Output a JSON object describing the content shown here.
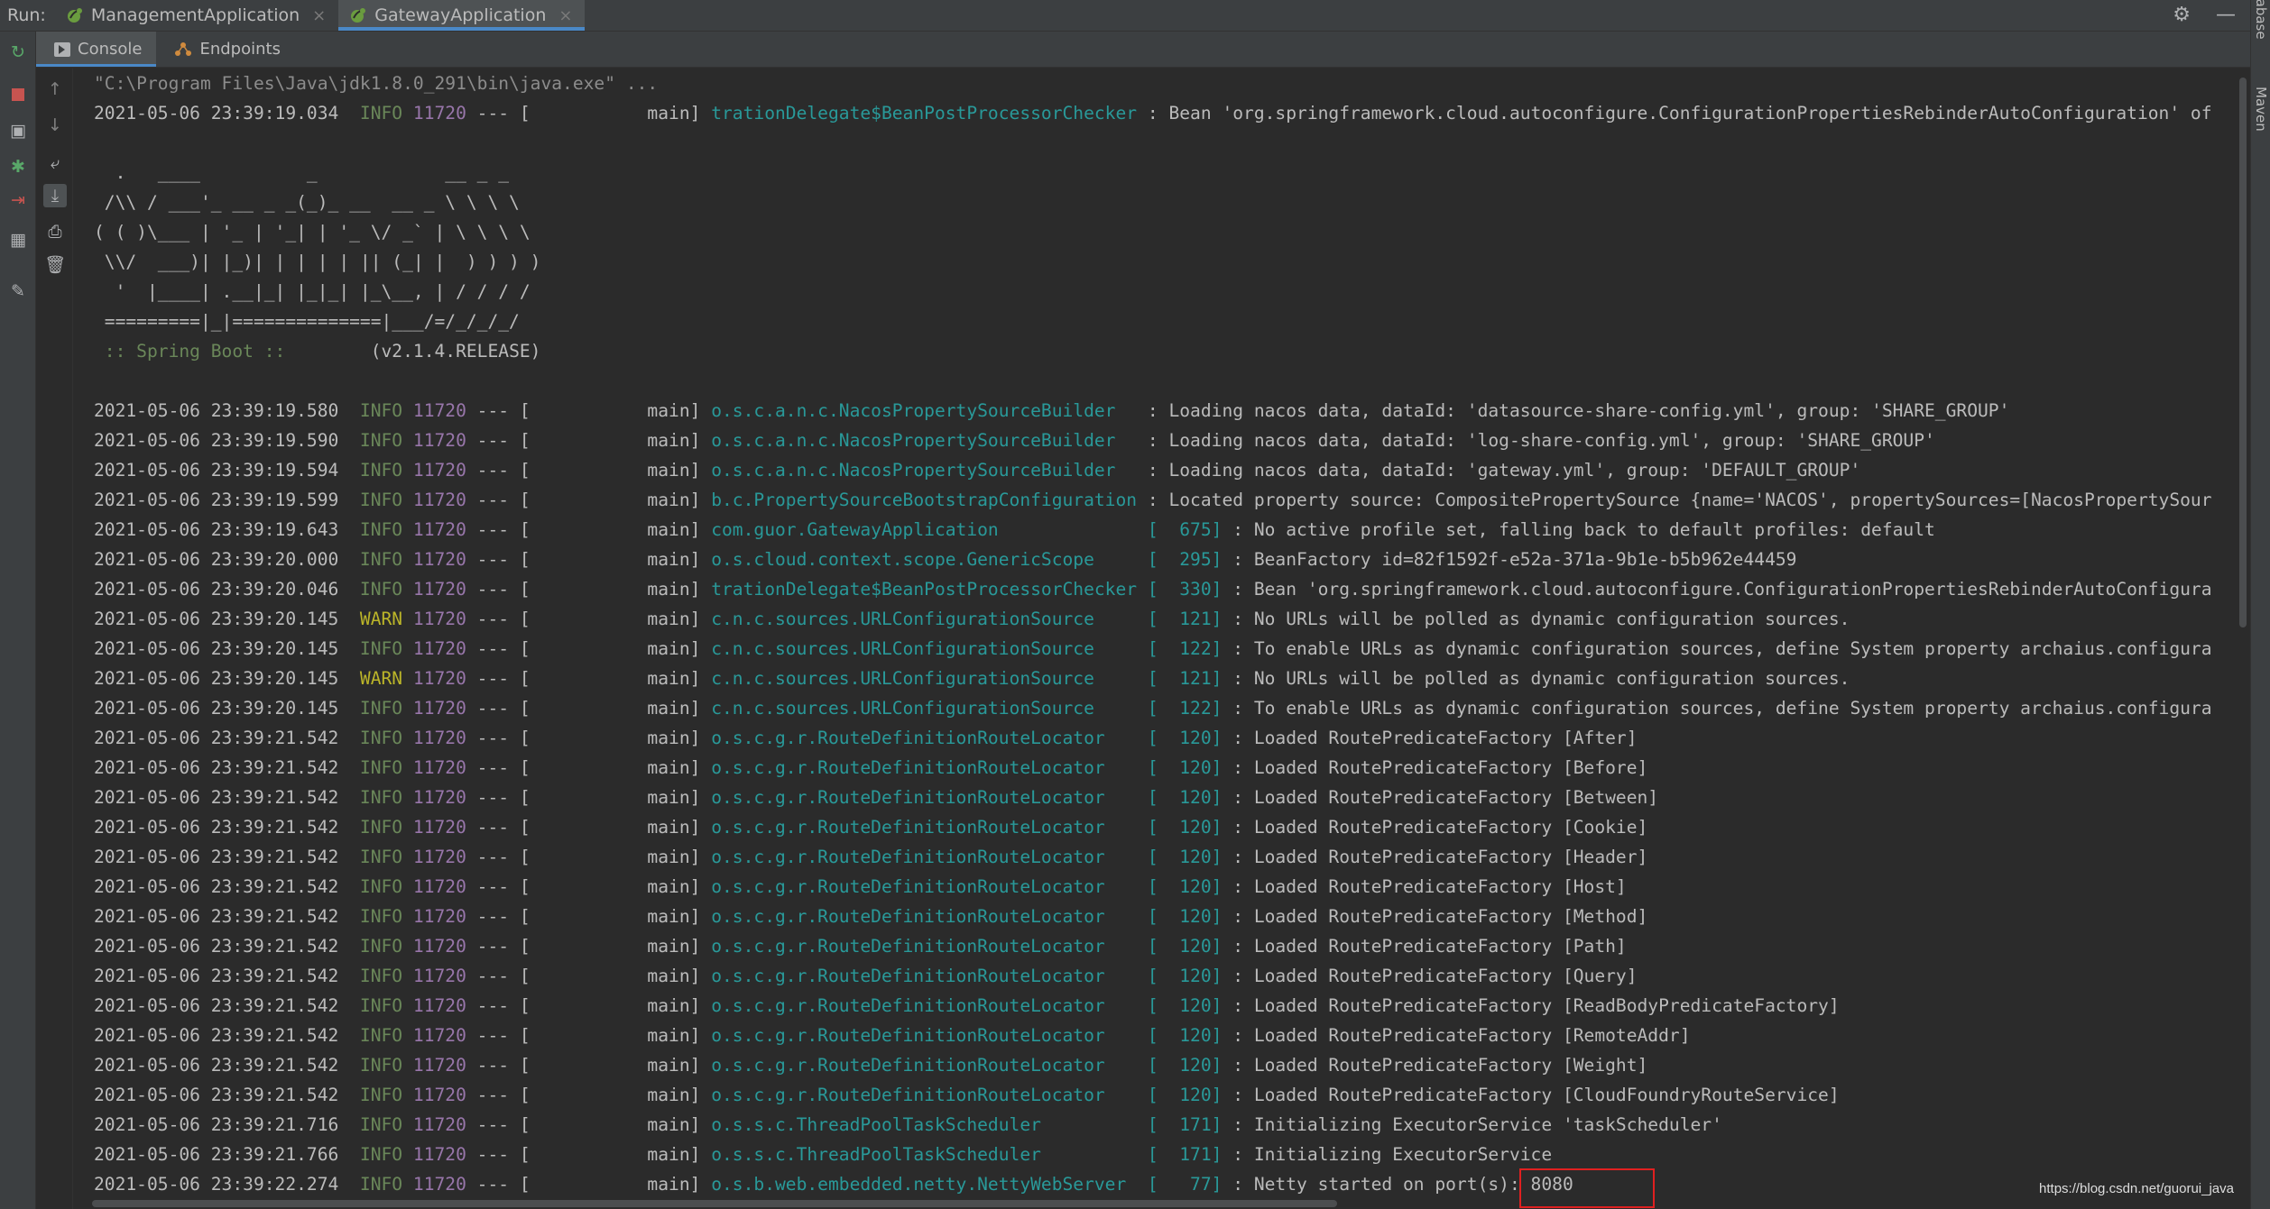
{
  "runbar": {
    "label": "Run:",
    "tabs": [
      {
        "label": "ManagementApplication",
        "active": false
      },
      {
        "label": "GatewayApplication",
        "active": true
      }
    ],
    "close_glyph": "×"
  },
  "right_strip": {
    "labels": [
      "Database",
      "Maven"
    ]
  },
  "subtabs": [
    {
      "label": "Console",
      "active": true
    },
    {
      "label": "Endpoints",
      "active": false
    }
  ],
  "colors": {
    "info": "#6a8759",
    "warn": "#bbb529",
    "pid": "#9876aa",
    "logger": "#299999",
    "highlight": "#e02020",
    "tab_accent": "#4a88c7"
  },
  "console": {
    "command": "\"C:\\Program Files\\Java\\jdk1.8.0_291\\bin\\java.exe\" ...",
    "first_log": {
      "ts": "2021-05-06 23:39:19.034",
      "level": "INFO",
      "pid": "11720",
      "sep": " --- [",
      "thread": "           main]",
      "logger": "trationDelegate$BeanPostProcessorChecker",
      "msg": " : Bean 'org.springframework.cloud.autoconfigure.ConfigurationPropertiesRebinderAutoConfiguration' of"
    },
    "banner": [
      "  .   ____          _            __ _ _",
      " /\\\\ / ___'_ __ _ _(_)_ __  __ _ \\ \\ \\ \\",
      "( ( )\\___ | '_ | '_| | '_ \\/ _` | \\ \\ \\ \\",
      " \\\\/  ___)| |_)| | | | | || (_| |  ) ) ) )",
      "  '  |____| .__|_| |_|_| |_\\__, | / / / /",
      " =========|_|==============|___/=/_/_/_/"
    ],
    "spring_boot_label": " :: Spring Boot :: ",
    "spring_boot_version": "       (v2.1.4.RELEASE)",
    "logs": [
      {
        "ts": "2021-05-06 23:39:19.580",
        "level": "INFO",
        "pid": "11720",
        "logger": "o.s.c.a.n.c.NacosPropertySourceBuilder  ",
        "lnum": "",
        "msg": " : Loading nacos data, dataId: 'datasource-share-config.yml', group: 'SHARE_GROUP'"
      },
      {
        "ts": "2021-05-06 23:39:19.590",
        "level": "INFO",
        "pid": "11720",
        "logger": "o.s.c.a.n.c.NacosPropertySourceBuilder  ",
        "lnum": "",
        "msg": " : Loading nacos data, dataId: 'log-share-config.yml', group: 'SHARE_GROUP'"
      },
      {
        "ts": "2021-05-06 23:39:19.594",
        "level": "INFO",
        "pid": "11720",
        "logger": "o.s.c.a.n.c.NacosPropertySourceBuilder  ",
        "lnum": "",
        "msg": " : Loading nacos data, dataId: 'gateway.yml', group: 'DEFAULT_GROUP'"
      },
      {
        "ts": "2021-05-06 23:39:19.599",
        "level": "INFO",
        "pid": "11720",
        "logger": "b.c.PropertySourceBootstrapConfiguration",
        "lnum": "",
        "msg": " : Located property source: CompositePropertySource {name='NACOS', propertySources=[NacosPropertySour"
      },
      {
        "ts": "2021-05-06 23:39:19.643",
        "level": "INFO",
        "pid": "11720",
        "logger": "com.guor.GatewayApplication             ",
        "lnum": "[  675]",
        "msg": " : No active profile set, falling back to default profiles: default"
      },
      {
        "ts": "2021-05-06 23:39:20.000",
        "level": "INFO",
        "pid": "11720",
        "logger": "o.s.cloud.context.scope.GenericScope    ",
        "lnum": "[  295]",
        "msg": " : BeanFactory id=82f1592f-e52a-371a-9b1e-b5b962e44459"
      },
      {
        "ts": "2021-05-06 23:39:20.046",
        "level": "INFO",
        "pid": "11720",
        "logger": "trationDelegate$BeanPostProcessorChecker",
        "lnum": "[  330]",
        "msg": " : Bean 'org.springframework.cloud.autoconfigure.ConfigurationPropertiesRebinderAutoConfigura"
      },
      {
        "ts": "2021-05-06 23:39:20.145",
        "level": "WARN",
        "pid": "11720",
        "logger": "c.n.c.sources.URLConfigurationSource    ",
        "lnum": "[  121]",
        "msg": " : No URLs will be polled as dynamic configuration sources."
      },
      {
        "ts": "2021-05-06 23:39:20.145",
        "level": "INFO",
        "pid": "11720",
        "logger": "c.n.c.sources.URLConfigurationSource    ",
        "lnum": "[  122]",
        "msg": " : To enable URLs as dynamic configuration sources, define System property archaius.configura"
      },
      {
        "ts": "2021-05-06 23:39:20.145",
        "level": "WARN",
        "pid": "11720",
        "logger": "c.n.c.sources.URLConfigurationSource    ",
        "lnum": "[  121]",
        "msg": " : No URLs will be polled as dynamic configuration sources."
      },
      {
        "ts": "2021-05-06 23:39:20.145",
        "level": "INFO",
        "pid": "11720",
        "logger": "c.n.c.sources.URLConfigurationSource    ",
        "lnum": "[  122]",
        "msg": " : To enable URLs as dynamic configuration sources, define System property archaius.configura"
      },
      {
        "ts": "2021-05-06 23:39:21.542",
        "level": "INFO",
        "pid": "11720",
        "logger": "o.s.c.g.r.RouteDefinitionRouteLocator   ",
        "lnum": "[  120]",
        "msg": " : Loaded RoutePredicateFactory [After]"
      },
      {
        "ts": "2021-05-06 23:39:21.542",
        "level": "INFO",
        "pid": "11720",
        "logger": "o.s.c.g.r.RouteDefinitionRouteLocator   ",
        "lnum": "[  120]",
        "msg": " : Loaded RoutePredicateFactory [Before]"
      },
      {
        "ts": "2021-05-06 23:39:21.542",
        "level": "INFO",
        "pid": "11720",
        "logger": "o.s.c.g.r.RouteDefinitionRouteLocator   ",
        "lnum": "[  120]",
        "msg": " : Loaded RoutePredicateFactory [Between]"
      },
      {
        "ts": "2021-05-06 23:39:21.542",
        "level": "INFO",
        "pid": "11720",
        "logger": "o.s.c.g.r.RouteDefinitionRouteLocator   ",
        "lnum": "[  120]",
        "msg": " : Loaded RoutePredicateFactory [Cookie]"
      },
      {
        "ts": "2021-05-06 23:39:21.542",
        "level": "INFO",
        "pid": "11720",
        "logger": "o.s.c.g.r.RouteDefinitionRouteLocator   ",
        "lnum": "[  120]",
        "msg": " : Loaded RoutePredicateFactory [Header]"
      },
      {
        "ts": "2021-05-06 23:39:21.542",
        "level": "INFO",
        "pid": "11720",
        "logger": "o.s.c.g.r.RouteDefinitionRouteLocator   ",
        "lnum": "[  120]",
        "msg": " : Loaded RoutePredicateFactory [Host]"
      },
      {
        "ts": "2021-05-06 23:39:21.542",
        "level": "INFO",
        "pid": "11720",
        "logger": "o.s.c.g.r.RouteDefinitionRouteLocator   ",
        "lnum": "[  120]",
        "msg": " : Loaded RoutePredicateFactory [Method]"
      },
      {
        "ts": "2021-05-06 23:39:21.542",
        "level": "INFO",
        "pid": "11720",
        "logger": "o.s.c.g.r.RouteDefinitionRouteLocator   ",
        "lnum": "[  120]",
        "msg": " : Loaded RoutePredicateFactory [Path]"
      },
      {
        "ts": "2021-05-06 23:39:21.542",
        "level": "INFO",
        "pid": "11720",
        "logger": "o.s.c.g.r.RouteDefinitionRouteLocator   ",
        "lnum": "[  120]",
        "msg": " : Loaded RoutePredicateFactory [Query]"
      },
      {
        "ts": "2021-05-06 23:39:21.542",
        "level": "INFO",
        "pid": "11720",
        "logger": "o.s.c.g.r.RouteDefinitionRouteLocator   ",
        "lnum": "[  120]",
        "msg": " : Loaded RoutePredicateFactory [ReadBodyPredicateFactory]"
      },
      {
        "ts": "2021-05-06 23:39:21.542",
        "level": "INFO",
        "pid": "11720",
        "logger": "o.s.c.g.r.RouteDefinitionRouteLocator   ",
        "lnum": "[  120]",
        "msg": " : Loaded RoutePredicateFactory [RemoteAddr]"
      },
      {
        "ts": "2021-05-06 23:39:21.542",
        "level": "INFO",
        "pid": "11720",
        "logger": "o.s.c.g.r.RouteDefinitionRouteLocator   ",
        "lnum": "[  120]",
        "msg": " : Loaded RoutePredicateFactory [Weight]"
      },
      {
        "ts": "2021-05-06 23:39:21.542",
        "level": "INFO",
        "pid": "11720",
        "logger": "o.s.c.g.r.RouteDefinitionRouteLocator   ",
        "lnum": "[  120]",
        "msg": " : Loaded RoutePredicateFactory [CloudFoundryRouteService]"
      },
      {
        "ts": "2021-05-06 23:39:21.716",
        "level": "INFO",
        "pid": "11720",
        "logger": "o.s.s.c.ThreadPoolTaskScheduler         ",
        "lnum": "[  171]",
        "msg": " : Initializing ExecutorService 'taskScheduler'"
      },
      {
        "ts": "2021-05-06 23:39:21.766",
        "level": "INFO",
        "pid": "11720",
        "logger": "o.s.s.c.ThreadPoolTaskScheduler         ",
        "lnum": "[  171]",
        "msg": " : Initializing ExecutorService"
      },
      {
        "ts": "2021-05-06 23:39:22.274",
        "level": "INFO",
        "pid": "11720",
        "logger": "o.s.b.web.embedded.netty.NettyWebServer ",
        "lnum": "[   77]",
        "msg": " : Netty started on port(s): 8080"
      }
    ],
    "thread_prefix": " --- [           main] "
  },
  "watermark": "https://blog.csdn.net/guorui_java"
}
